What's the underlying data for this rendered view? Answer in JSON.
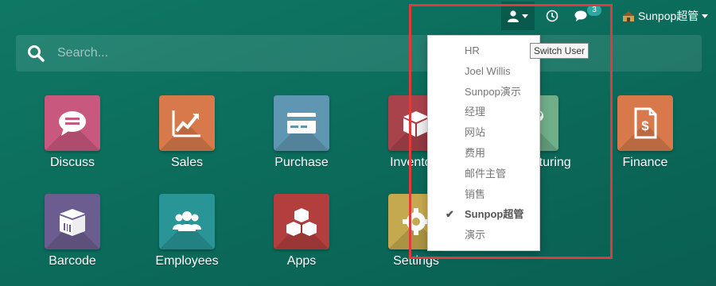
{
  "topbar": {
    "chat_badge": "3",
    "company": "Sunpop超管"
  },
  "search": {
    "placeholder": "Search..."
  },
  "apps": [
    {
      "label": "Discuss",
      "color": "#c9587f",
      "icon": "chat-bubble-icon"
    },
    {
      "label": "Sales",
      "color": "#d7794a",
      "icon": "trending-up-icon"
    },
    {
      "label": "Purchase",
      "color": "#5f97b3",
      "icon": "credit-card-icon"
    },
    {
      "label": "Inventory",
      "color": "#a8424b",
      "icon": "box-icon"
    },
    {
      "label": "Manufacturing",
      "color": "#6fae88",
      "icon": "wrench-icon"
    },
    {
      "label": "Finance",
      "color": "#d7794a",
      "icon": "invoice-icon"
    },
    {
      "label": "Barcode",
      "color": "#6b5d8f",
      "icon": "barcode-box-icon"
    },
    {
      "label": "Employees",
      "color": "#2a9596",
      "icon": "users-icon"
    },
    {
      "label": "Apps",
      "color": "#b23e3e",
      "icon": "cubes-icon"
    },
    {
      "label": "Settings",
      "color": "#c5a94e",
      "icon": "gear-icon"
    }
  ],
  "dropdown": {
    "items": [
      "HR",
      "Joel Willis",
      "Sunpop演示",
      "经理",
      "网站",
      "费用",
      "邮件主管",
      "销售",
      "Sunpop超管",
      "演示"
    ],
    "active": "Sunpop超管"
  },
  "tooltip": "Switch User",
  "colors": {
    "background": "#0f7864",
    "highlight": "#e03a3a"
  }
}
